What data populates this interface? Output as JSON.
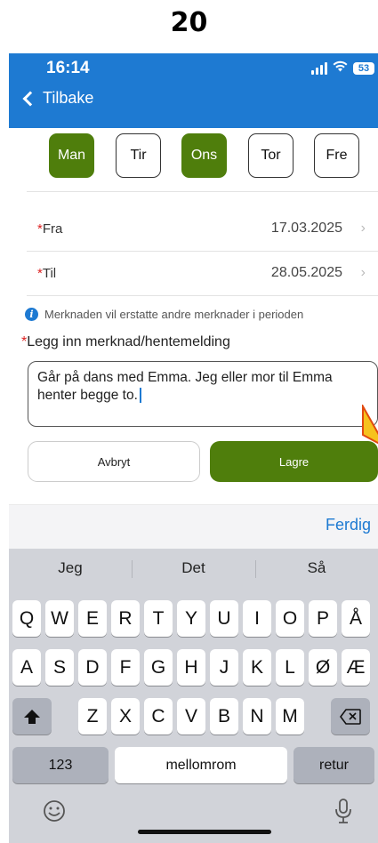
{
  "page_number": "20",
  "status_bar": {
    "time": "16:14",
    "battery": "53"
  },
  "nav": {
    "back_label": "Tilbake"
  },
  "weekdays": [
    {
      "label": "Man",
      "selected": true
    },
    {
      "label": "Tir",
      "selected": false
    },
    {
      "label": "Ons",
      "selected": true
    },
    {
      "label": "Tor",
      "selected": false
    },
    {
      "label": "Fre",
      "selected": false
    }
  ],
  "from_row": {
    "required_mark": "*",
    "label": "Fra",
    "value": "17.03.2025"
  },
  "to_row": {
    "required_mark": "*",
    "label": "Til",
    "value": "28.05.2025"
  },
  "info_text": "Merknaden vil erstatte andre merknader i perioden",
  "note": {
    "required_mark": "*",
    "label": "Legg inn merknad/hentemelding",
    "value": "Går på dans med Emma. Jeg eller mor til Emma henter begge to."
  },
  "buttons": {
    "cancel": "Avbryt",
    "save": "Lagre"
  },
  "toolbar": {
    "done": "Ferdig"
  },
  "keyboard": {
    "suggestions": [
      "Jeg",
      "Det",
      "Så"
    ],
    "row1": [
      "Q",
      "W",
      "E",
      "R",
      "T",
      "Y",
      "U",
      "I",
      "O",
      "P",
      "Å"
    ],
    "row2": [
      "A",
      "S",
      "D",
      "F",
      "G",
      "H",
      "J",
      "K",
      "L",
      "Ø",
      "Æ"
    ],
    "row3": [
      "Z",
      "X",
      "C",
      "V",
      "B",
      "N",
      "M"
    ],
    "numbers_key": "123",
    "space_key": "mellomrom",
    "return_key": "retur"
  },
  "colors": {
    "header_blue": "#1e7ad2",
    "accent_green": "#4f7e0c",
    "pointer_yellow": "#f6c21d"
  }
}
